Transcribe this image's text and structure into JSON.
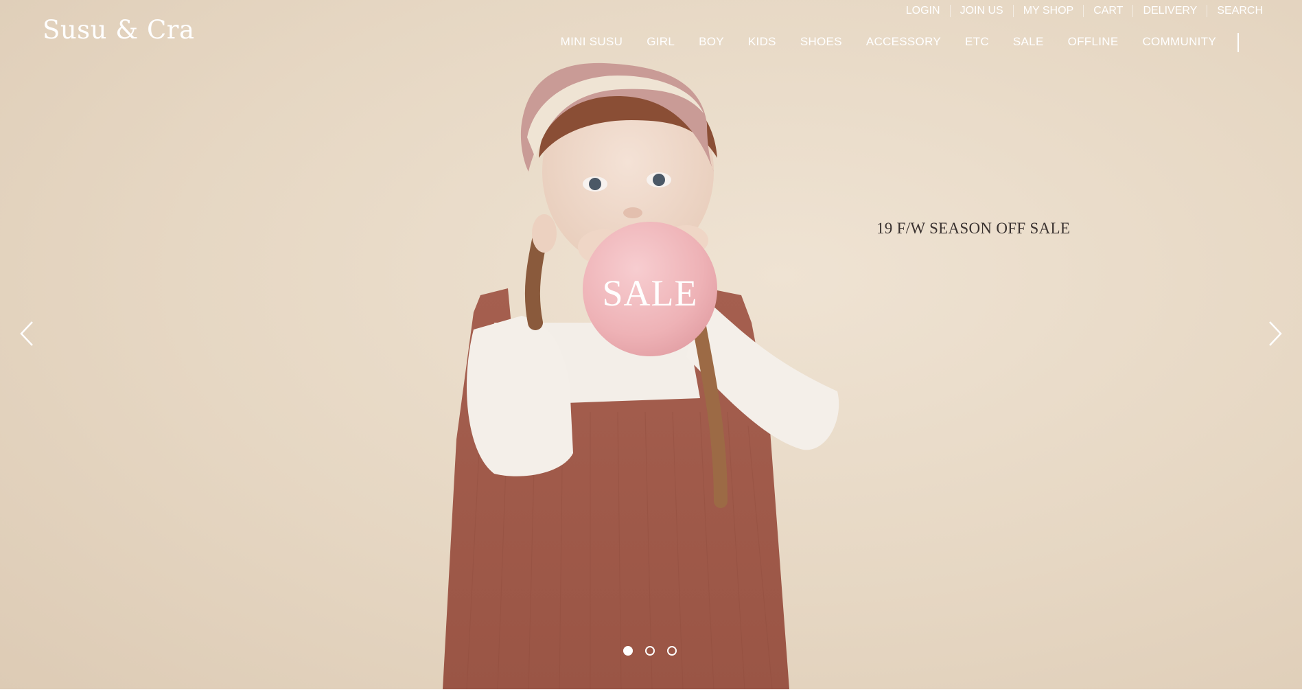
{
  "header": {
    "logo": "Susu & Cra",
    "util_nav": [
      "LOGIN",
      "JOIN US",
      "MY SHOP",
      "CART",
      "DELIVERY",
      "SEARCH"
    ],
    "main_nav": [
      "MINI SUSU",
      "GIRL",
      "BOY",
      "KIDS",
      "SHOES",
      "ACCESSORY",
      "ETC",
      "SALE",
      "OFFLINE",
      "COMMUNITY"
    ]
  },
  "hero": {
    "caption": "19 F/W SEASON OFF SALE",
    "balloon_text": "SALE",
    "slide_count": 3,
    "active_slide": 1,
    "prev_icon": "chevron-left-icon",
    "next_icon": "chevron-right-icon"
  },
  "colors": {
    "background": "#e6d7c3",
    "text_light": "#ffffff",
    "caption_text": "#3a3230",
    "balloon": "#f0b9bc",
    "dress": "#a76050"
  }
}
